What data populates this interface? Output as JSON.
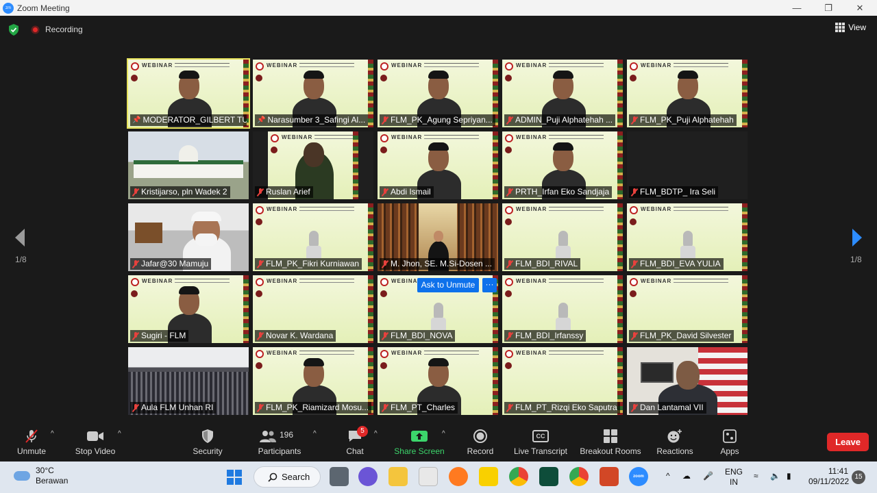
{
  "window": {
    "title": "Zoom Meeting"
  },
  "topbar": {
    "recording_label": "Recording",
    "view_label": "View"
  },
  "gallery": {
    "page_left": "1/8",
    "page_right": "1/8",
    "ask_unmute": "Ask to Unmute",
    "more": "···",
    "tiles": [
      {
        "name": "MODERATOR_GILBERT TU..."
      },
      {
        "name": "Narasumber 3_Safingi Al..."
      },
      {
        "name": "FLM_PK_Agung Sepriyan..."
      },
      {
        "name": "ADMIN_Puji Alphatehah ..."
      },
      {
        "name": "FLM_PK_Puji Alphatehah"
      },
      {
        "name": "Kristijarso, pln Wadek 2"
      },
      {
        "name": "Ruslan Arief"
      },
      {
        "name": "Abdi Ismail"
      },
      {
        "name": "PRTH_Irfan Eko Sandjaja"
      },
      {
        "name": "FLM_BDTP_ Ira Seli"
      },
      {
        "name": "Jafar@30 Mamuju"
      },
      {
        "name": "FLM_PK_Fikri Kurniawan"
      },
      {
        "name": "M. Jhon, SE. M.Si-Dosen ..."
      },
      {
        "name": "FLM_BDI_RIVAL"
      },
      {
        "name": "FLM_BDI_EVA YULIA"
      },
      {
        "name": "Sugiri - FLM"
      },
      {
        "name": "Novar K. Wardana"
      },
      {
        "name": "FLM_BDI_NOVA"
      },
      {
        "name": "FLM_BDI_Irfanssy"
      },
      {
        "name": "FLM_PK_David Silvester"
      },
      {
        "name": "Aula FLM Unhan RI"
      },
      {
        "name": "FLM_PK_Riamizard Mosu..."
      },
      {
        "name": "FLM_PT_Charles"
      },
      {
        "name": "FLM_PT_Rizqi Eko Saputra"
      },
      {
        "name": "Dan Lantamal VII"
      }
    ],
    "webinar_label": "WEBINAR"
  },
  "toolbar": {
    "unmute": "Unmute",
    "stop_video": "Stop Video",
    "security": "Security",
    "participants": "Participants",
    "participants_count": "196",
    "chat": "Chat",
    "chat_badge": "5",
    "share_screen": "Share Screen",
    "record": "Record",
    "live_transcript": "Live Transcript",
    "cc": "CC",
    "breakout_rooms": "Breakout Rooms",
    "reactions": "Reactions",
    "apps": "Apps",
    "leave": "Leave"
  },
  "taskbar": {
    "temperature": "30°C",
    "weather": "Berawan",
    "search": "Search",
    "lang1": "ENG",
    "lang2": "IN",
    "time": "11:41",
    "date": "09/11/2022",
    "notifications": "15"
  },
  "colors": {
    "accent": "#0e71eb",
    "leave": "#e02828",
    "share": "#3cd56b",
    "active_speaker": "#e6e25b"
  }
}
